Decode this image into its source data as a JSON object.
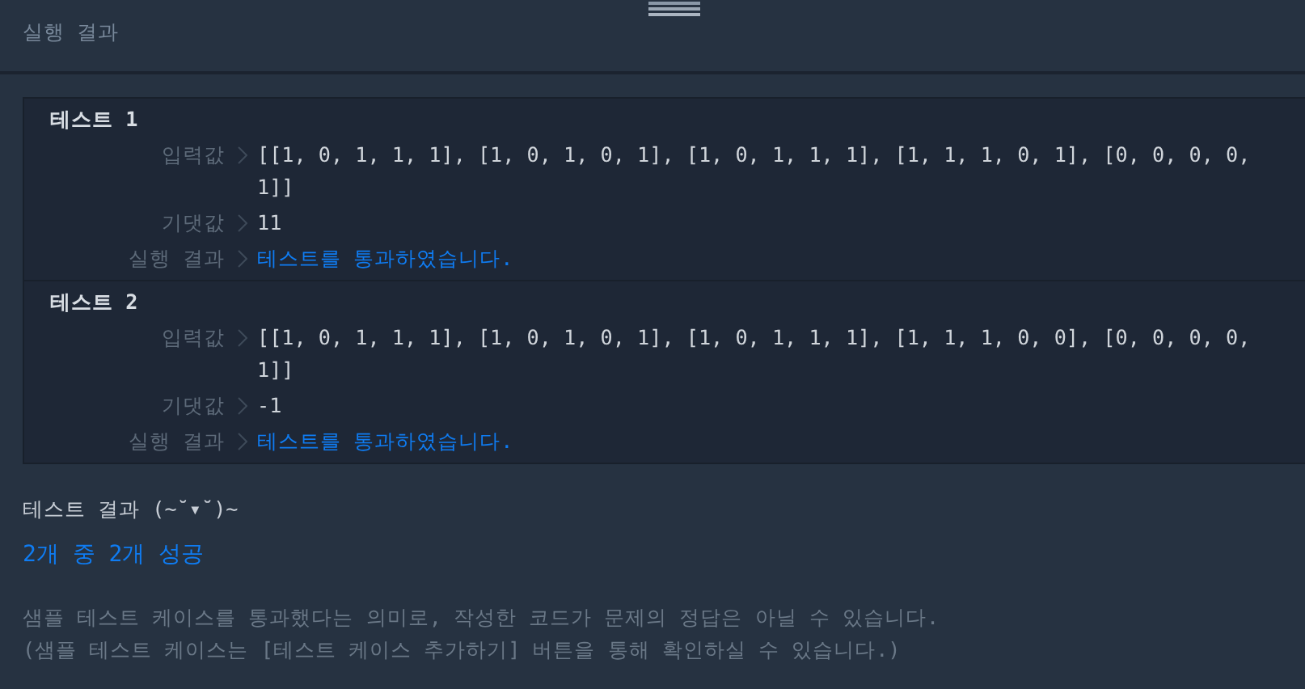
{
  "header": {
    "title": "실행 결과"
  },
  "tests": [
    {
      "title": "테스트 1",
      "rows": [
        {
          "label": "입력값",
          "value": "[[1, 0, 1, 1, 1], [1, 0, 1, 0, 1], [1, 0, 1, 1, 1], [1, 1, 1, 0, 1], [0, 0, 0, 0, 1]]",
          "kind": "plain"
        },
        {
          "label": "기댓값",
          "value": "11",
          "kind": "plain"
        },
        {
          "label": "실행 결과",
          "value": "테스트를 통과하였습니다.",
          "kind": "pass"
        }
      ]
    },
    {
      "title": "테스트 2",
      "rows": [
        {
          "label": "입력값",
          "value": "[[1, 0, 1, 1, 1], [1, 0, 1, 0, 1], [1, 0, 1, 1, 1], [1, 1, 1, 0, 0], [0, 0, 0, 0, 1]]",
          "kind": "plain"
        },
        {
          "label": "기댓값",
          "value": "-1",
          "kind": "plain"
        },
        {
          "label": "실행 결과",
          "value": "테스트를 통과하였습니다.",
          "kind": "pass"
        }
      ]
    }
  ],
  "summary": {
    "heading": "테스트 결과 (~˘▾˘)~",
    "result": "2개 중 2개 성공",
    "notes": [
      "샘플 테스트 케이스를 통과했다는 의미로, 작성한 코드가 문제의 정답은 아닐 수 있습니다.",
      "(샘플 테스트 케이스는 [테스트 케이스 추가하기] 버튼을 통해 확인하실 수 있습니다.)"
    ]
  }
}
